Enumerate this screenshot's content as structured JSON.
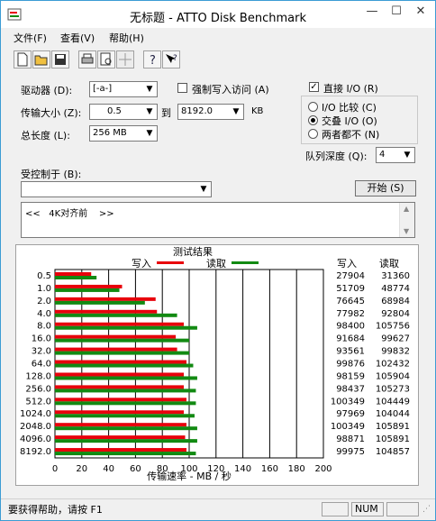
{
  "window": {
    "title": "无标题 - ATTO Disk Benchmark",
    "controls": {
      "minimize": "—",
      "maximize": "☐",
      "close": "✕"
    }
  },
  "menu": [
    "文件(F)",
    "查看(V)",
    "帮助(H)"
  ],
  "toolbar": {
    "icons": [
      "new-icon",
      "open-icon",
      "save-icon",
      "print-icon",
      "print-preview-icon",
      "move-icon",
      "help-icon",
      "context-help-icon"
    ]
  },
  "settings": {
    "drive_label": "驱动器 (D):",
    "drive_value": "[-a-]",
    "force_write_label": "强制写入访问 (A)",
    "force_write_checked": false,
    "transfer_label": "传输大小 (Z):",
    "transfer_from": "0.5",
    "to_label": "到",
    "transfer_to": "8192.0",
    "transfer_unit": "KB",
    "length_label": "总长度 (L):",
    "length_value": "256 MB",
    "direct_io_label": "直接 I/O (R)",
    "direct_io_checked": true,
    "io_options": [
      "I/O 比较 (C)",
      "交叠 I/O (O)",
      "两者都不 (N)"
    ],
    "io_selected": 1,
    "queue_label": "队列深度 (Q):",
    "queue_value": "4",
    "controlled_label": "受控制于 (B):",
    "controlled_value": "",
    "start_button": "开始 (S)",
    "notes": "<<   4K对齐前    >>"
  },
  "results": {
    "title": "测试结果",
    "legend_write": "写入",
    "legend_read": "读取",
    "col_write": "写入",
    "col_read": "读取",
    "xaxis_label": "传输速率 - MB / 秒",
    "ticks": [
      "0",
      "20",
      "40",
      "60",
      "80",
      "100",
      "120",
      "140",
      "160",
      "180",
      "200"
    ],
    "write_color": "#e8000b",
    "read_color": "#128a12"
  },
  "chart_data": {
    "type": "bar",
    "title": "测试结果",
    "xlabel": "传输速率 - MB / 秒",
    "xlim": [
      0,
      200
    ],
    "grid": true,
    "legend": "top",
    "categories": [
      "0.5",
      "1.0",
      "2.0",
      "4.0",
      "8.0",
      "16.0",
      "32.0",
      "64.0",
      "128.0",
      "256.0",
      "512.0",
      "1024.0",
      "2048.0",
      "4096.0",
      "8192.0"
    ],
    "series": [
      {
        "name": "写入",
        "bar_values": [
          27,
          50,
          75,
          76,
          96,
          90,
          91,
          98,
          96,
          96,
          98,
          96,
          98,
          97,
          98
        ],
        "values": [
          27904,
          51709,
          76645,
          77982,
          98400,
          91684,
          93561,
          99876,
          98159,
          98437,
          100349,
          97969,
          100349,
          98871,
          99975
        ]
      },
      {
        "name": "读取",
        "bar_values": [
          31,
          48,
          67,
          91,
          106,
          100,
          100,
          103,
          106,
          105,
          105,
          104,
          106,
          106,
          105
        ],
        "values": [
          31360,
          48774,
          68984,
          92804,
          105756,
          99627,
          99832,
          102432,
          105904,
          105273,
          104449,
          104044,
          105891,
          105891,
          104857
        ]
      }
    ]
  },
  "status": {
    "text": "要获得帮助，请按 F1",
    "num": "NUM"
  }
}
